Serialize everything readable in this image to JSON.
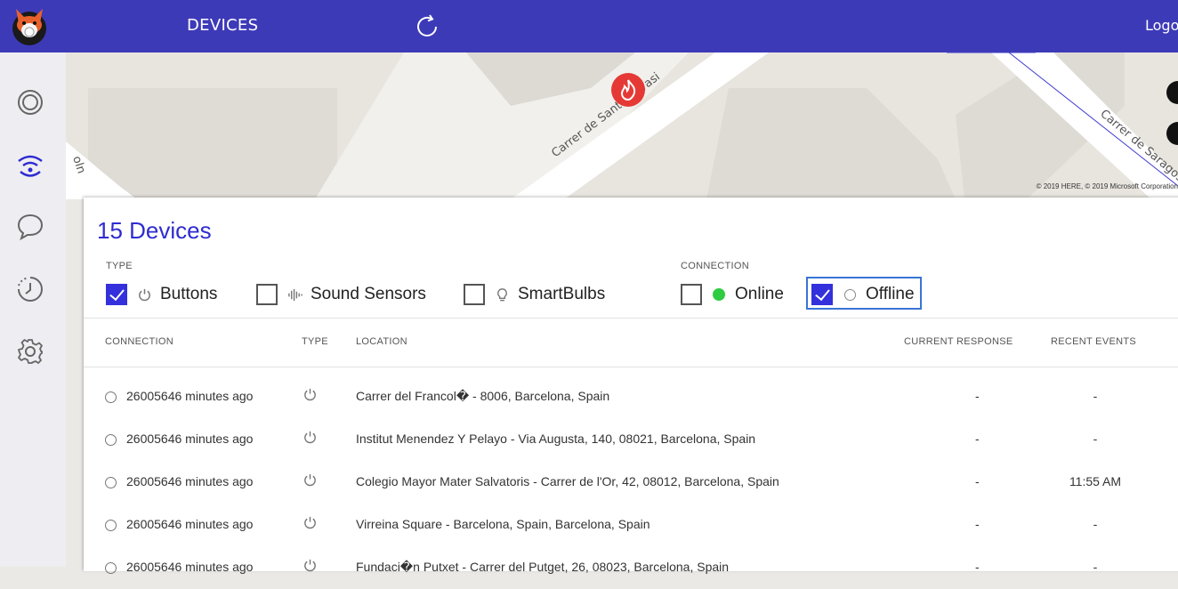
{
  "header": {
    "title": "DEVICES",
    "logout_label": "Logout"
  },
  "map": {
    "street_labels": [
      "Carrer de Sant Gervasi",
      "Carrer de Saragossa",
      "oln"
    ],
    "attribution": "© 2019 HERE, © 2019 Microsoft Corporation"
  },
  "panel": {
    "count_label": "15 Devices",
    "type_label": "TYPE",
    "connection_label": "CONNECTION",
    "filters": {
      "buttons": {
        "label": "Buttons",
        "checked": true
      },
      "sound_sensors": {
        "label": "Sound Sensors",
        "checked": false
      },
      "smartbulbs": {
        "label": "SmartBulbs",
        "checked": false
      },
      "online": {
        "label": "Online",
        "checked": false
      },
      "offline": {
        "label": "Offline",
        "checked": true
      }
    }
  },
  "table": {
    "columns": {
      "connection": "CONNECTION",
      "type": "TYPE",
      "location": "LOCATION",
      "current_response": "CURRENT RESPONSE",
      "recent_events": "RECENT EVENTS"
    },
    "rows": [
      {
        "connection": "26005646 minutes ago",
        "location": "Carrer del Francol� - 8006, Barcelona, Spain",
        "response": "-",
        "events": "-"
      },
      {
        "connection": "26005646 minutes ago",
        "location": "Institut Menendez Y Pelayo - Via Augusta, 140, 08021, Barcelona, Spain",
        "response": "-",
        "events": "-"
      },
      {
        "connection": "26005646 minutes ago",
        "location": "Colegio Mayor Mater Salvatoris - Carrer de l'Or, 42, 08012, Barcelona, Spain",
        "response": "-",
        "events": "11:55 AM"
      },
      {
        "connection": "26005646 minutes ago",
        "location": "Virreina Square - Barcelona, Spain, Barcelona, Spain",
        "response": "-",
        "events": "-"
      },
      {
        "connection": "26005646 minutes ago",
        "location": "Fundaci�n Putxet - Carrer del Putget, 26, 08023, Barcelona, Spain",
        "response": "-",
        "events": "-"
      }
    ]
  },
  "colors": {
    "topbar": "#3d3ab8",
    "accent": "#2f2bd1",
    "online_dot": "#2ecc40",
    "marker": "#e53935"
  }
}
